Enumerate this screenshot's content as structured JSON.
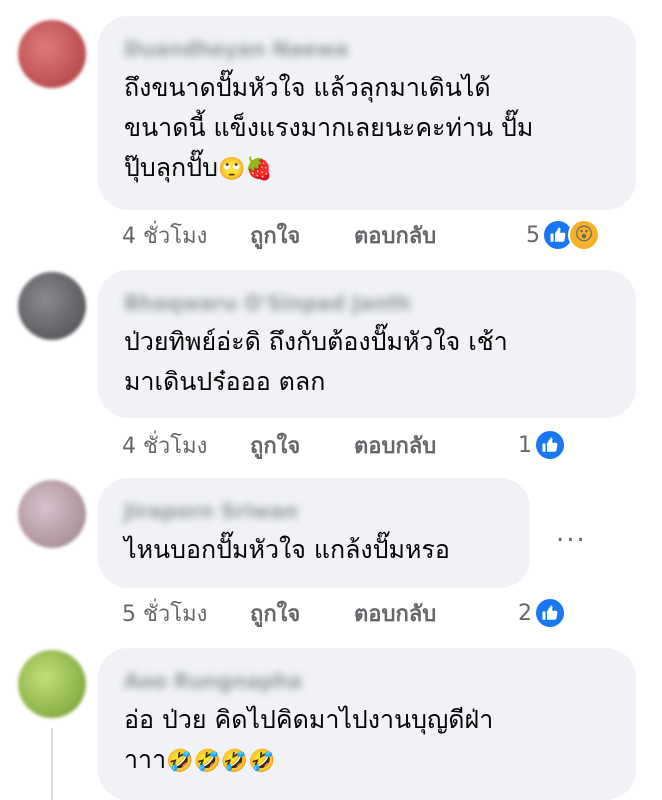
{
  "comments": [
    {
      "author": "Duandheyan Naewa",
      "text": "ถึงขนาดปั๊มหัวใจ แล้วลุกมาเดินได้\nขนาดนี้ แข็งแรงมากเลยนะคะท่าน ปั๊ม\nปุ๊บลุกปั๊บ",
      "emojis": "🙄🍓",
      "time": "4 ชั่วโมง",
      "like_label": "ถูกใจ",
      "reply_label": "ตอบกลับ",
      "reaction_count": "5",
      "reaction_icons": [
        "like-icon",
        "wow-icon"
      ],
      "avatar_color": "#c9585a"
    },
    {
      "author": "Bhaqwaru O'Sinpad Janth",
      "text": "ป่วยทิพย์อ่ะดิ ถึงกับต้องปั๊มหัวใจ เช้า\nมาเดินปร๋อออ ตลก",
      "emojis": "",
      "time": "4 ชั่วโมง",
      "like_label": "ถูกใจ",
      "reply_label": "ตอบกลับ",
      "reaction_count": "1",
      "reaction_icons": [
        "like-icon"
      ],
      "avatar_color": "#6b6b6f"
    },
    {
      "author": "Jiraporn Sriwan",
      "text": "ไหนบอกปั๊มหัวใจ แกล้งปั๊มหรอ",
      "emojis": "",
      "time": "5 ชั่วโมง",
      "like_label": "ถูกใจ",
      "reply_label": "ตอบกลับ",
      "reaction_count": "2",
      "reaction_icons": [
        "like-icon"
      ],
      "avatar_color": "#b49ca6",
      "more_label": "..."
    },
    {
      "author": "Aoo Rungnapha",
      "text": "อ่อ ป่วย คิดไปคิดมาไปงานบุญดีฝ่า\nาาา",
      "emojis": "🤣🤣🤣🤣",
      "avatar_color": "#9cc64a"
    }
  ],
  "colors": {
    "bubble_bg": "#f0f2f5",
    "meta_text": "#65676b",
    "like_blue": "#1877f2",
    "wow_yellow": "#f7b125"
  }
}
